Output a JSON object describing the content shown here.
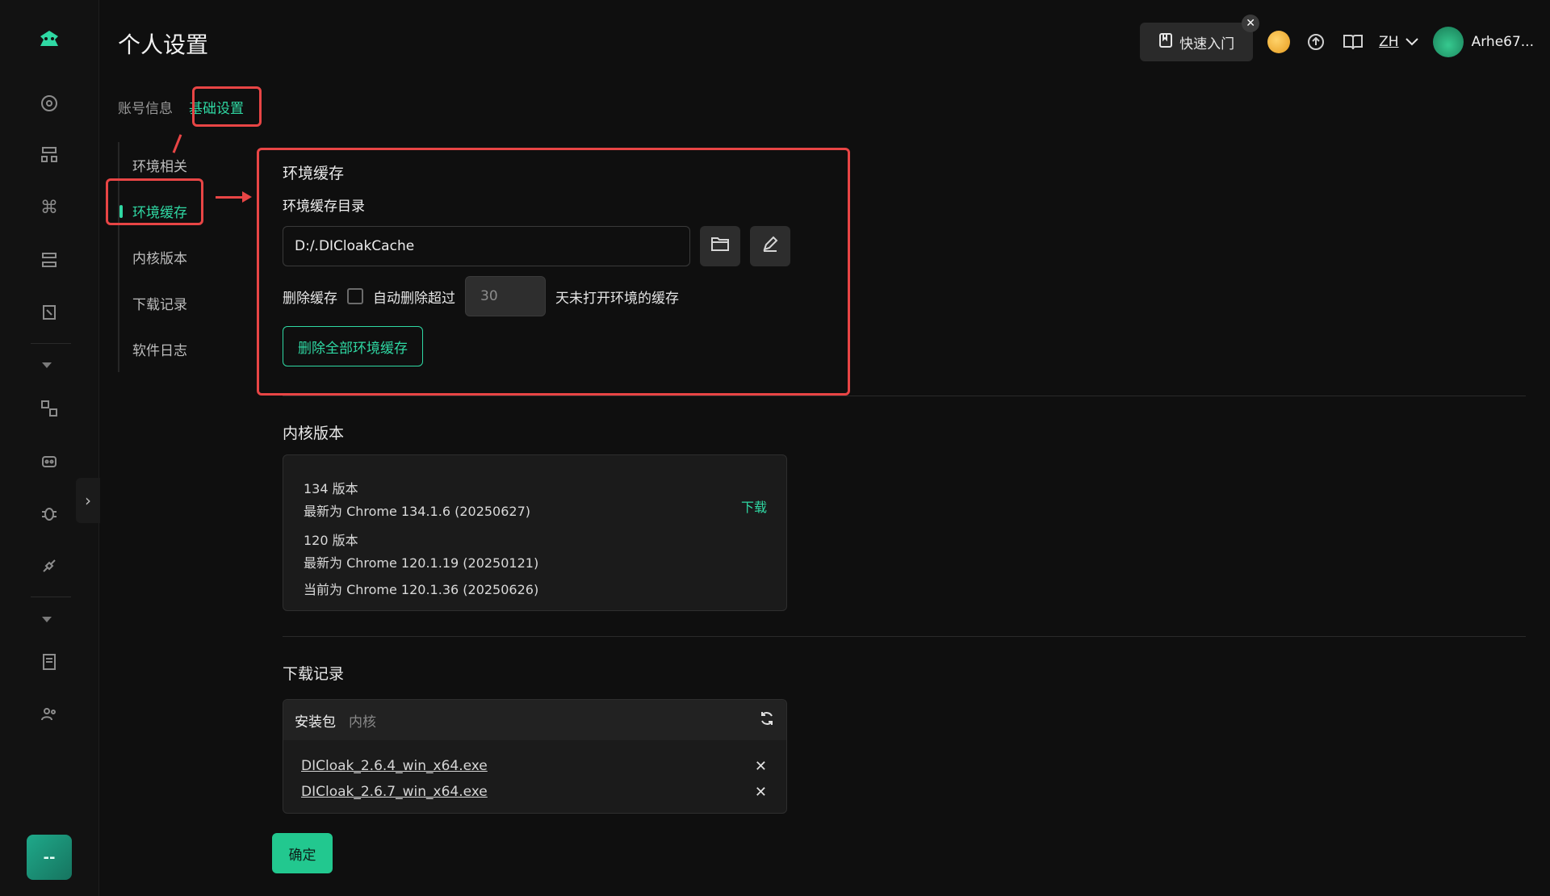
{
  "header": {
    "title": "个人设置",
    "quick_start_label": "快速入门",
    "lang": "ZH",
    "username": "Arhe67..."
  },
  "tabs": [
    {
      "label": "账号信息"
    },
    {
      "label": "基础设置"
    }
  ],
  "subnav": [
    {
      "label": "环境相关"
    },
    {
      "label": "环境缓存"
    },
    {
      "label": "内核版本"
    },
    {
      "label": "下载记录"
    },
    {
      "label": "软件日志"
    }
  ],
  "cache": {
    "title": "环境缓存",
    "dir_label": "环境缓存目录",
    "dir_value": "D:/.DICloakCache",
    "delete_label": "删除缓存",
    "auto_delete_label": "自动删除超过",
    "days_value": "30",
    "days_suffix": "天未打开环境的缓存",
    "delete_all_label": "删除全部环境缓存"
  },
  "kernel": {
    "title": "内核版本",
    "v134_name": "134 版本",
    "v134_latest": "最新为 Chrome 134.1.6 (20250627)",
    "download_label": "下载",
    "v120_name": "120 版本",
    "v120_latest": "最新为 Chrome 120.1.19 (20250121)",
    "v120_current": "当前为 Chrome 120.1.36 (20250626)"
  },
  "downloads": {
    "title": "下载记录",
    "tab_package": "安装包",
    "tab_kernel": "内核",
    "files": [
      "DICloak_2.6.4_win_x64.exe",
      "DICloak_2.6.7_win_x64.exe"
    ]
  },
  "confirm_label": "确定",
  "rail_user_label": "--",
  "colors": {
    "accent": "#2fd8a3",
    "annotation": "#e84545",
    "background": "#0f0f0f"
  }
}
